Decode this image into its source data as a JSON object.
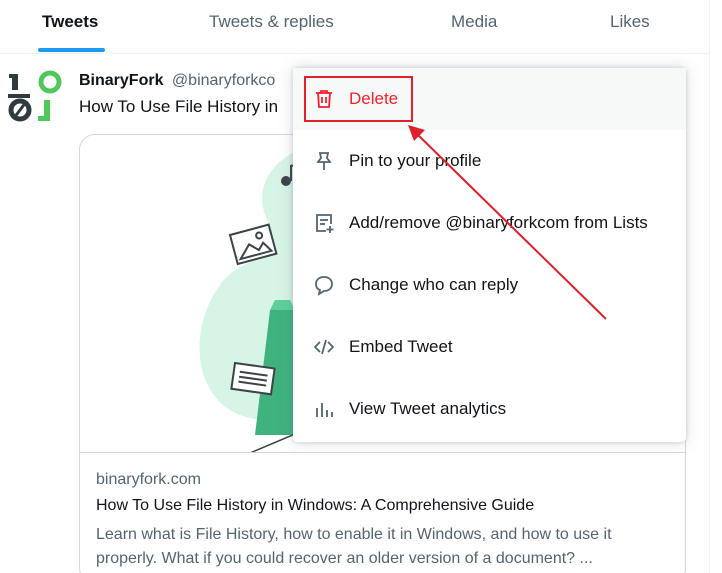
{
  "tabs": [
    {
      "label": "Tweets",
      "active": true
    },
    {
      "label": "Tweets & replies",
      "active": false
    },
    {
      "label": "Media",
      "active": false
    },
    {
      "label": "Likes",
      "active": false
    }
  ],
  "tweet": {
    "author_name": "BinaryFork",
    "author_handle": "@binaryforkco",
    "text": "How To Use File History in",
    "card": {
      "domain": "binaryfork.com",
      "title": "How To Use File History in Windows: A Comprehensive Guide",
      "description": "Learn what is File History, how to enable it in Windows, and how to use it properly. What if you could recover an older version of a document? ..."
    }
  },
  "menu": {
    "items": [
      {
        "label": "Delete",
        "icon": "trash-icon",
        "color": "#f4212e"
      },
      {
        "label": "Pin to your profile",
        "icon": "pin-icon"
      },
      {
        "label": "Add/remove @binaryforkcom from Lists",
        "icon": "list-add-icon"
      },
      {
        "label": "Change who can reply",
        "icon": "speech-bubble-icon"
      },
      {
        "label": "Embed Tweet",
        "icon": "code-icon"
      },
      {
        "label": "View Tweet analytics",
        "icon": "bar-chart-icon"
      }
    ]
  },
  "colors": {
    "accent": "#1d9bf0",
    "danger": "#f4212e",
    "annotation": "#e0202a",
    "brand_green": "#4fc75a"
  }
}
